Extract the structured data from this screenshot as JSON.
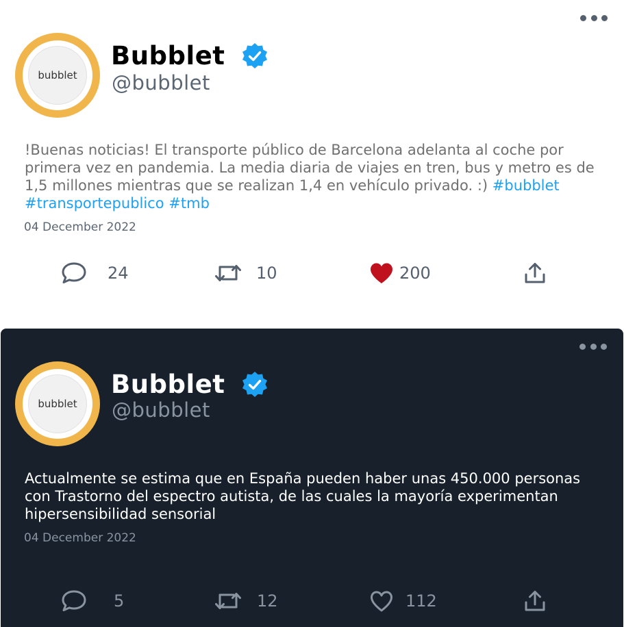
{
  "colors": {
    "accent": "#1da1f2",
    "like_active": "#c0121e",
    "dark_background": "#17202b",
    "avatar_ring": "#f0b64b"
  },
  "tweets": [
    {
      "theme": "light",
      "name": "Bubblet",
      "handle": "@bubblet",
      "avatar_text": "bubblet",
      "text": "!Buenas noticias! El transporte público de Barcelona adelanta al coche por primera vez en pandemia. La media diaria de viajes en tren, bus y metro es de 1,5 millones mientras que se realizan 1,4 en vehículo privado. :)  ",
      "hashtags": [
        "#bubblet",
        "#transportepublico",
        "#tmb"
      ],
      "date": "04 December 2022",
      "replies": "24",
      "retweets": "10",
      "likes": "200",
      "liked": true,
      "icons": {
        "reply": "comment-icon",
        "retweet": "retweet-icon",
        "like": "heart-icon",
        "share": "share-icon",
        "more": "more-icon",
        "verified": "verified-badge-icon"
      }
    },
    {
      "theme": "dark",
      "name": "Bubblet",
      "handle": "@bubblet",
      "avatar_text": "bubblet",
      "text": "Actualmente se estima que en España pueden haber unas 450.000 personas con Trastorno del espectro autista, de las cuales la mayoría experimentan hipersensibilidad sensorial",
      "hashtags": [],
      "date": "04 December 2022",
      "replies": "5",
      "retweets": "12",
      "likes": "112",
      "liked": false,
      "icons": {
        "reply": "comment-icon",
        "retweet": "retweet-icon",
        "like": "heart-outline-icon",
        "share": "share-icon",
        "more": "more-icon",
        "verified": "verified-badge-icon"
      }
    }
  ]
}
